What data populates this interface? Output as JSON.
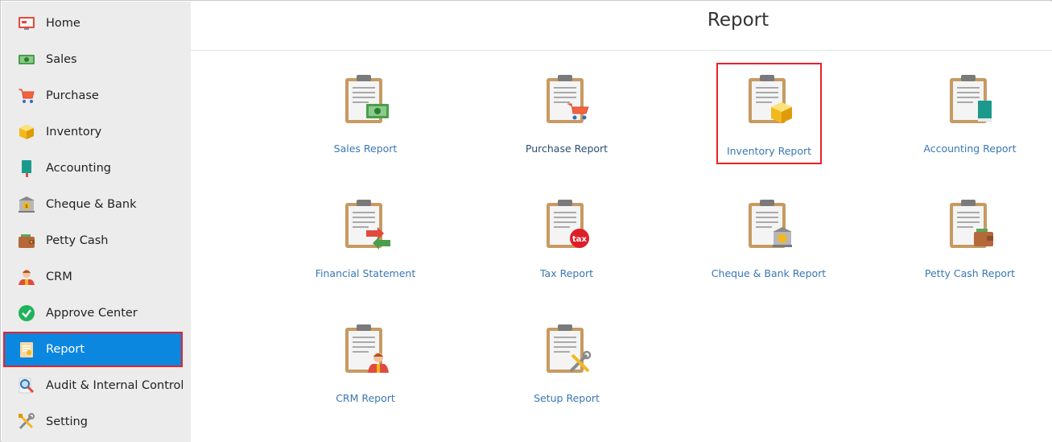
{
  "page": {
    "title": "Report"
  },
  "sidebar": {
    "items": [
      {
        "label": "Home",
        "icon": "home-monitor-icon"
      },
      {
        "label": "Sales",
        "icon": "cash-icon"
      },
      {
        "label": "Purchase",
        "icon": "cart-icon"
      },
      {
        "label": "Inventory",
        "icon": "box-icon"
      },
      {
        "label": "Accounting",
        "icon": "book-icon"
      },
      {
        "label": "Cheque & Bank",
        "icon": "bank-icon"
      },
      {
        "label": "Petty Cash",
        "icon": "wallet-icon"
      },
      {
        "label": "CRM",
        "icon": "people-icon"
      },
      {
        "label": "Approve Center",
        "icon": "check-circle-icon"
      },
      {
        "label": "Report",
        "icon": "report-icon",
        "active": true
      },
      {
        "label": "Audit & Internal Control",
        "icon": "magnifier-icon"
      },
      {
        "label": "Setting",
        "icon": "tools-icon"
      }
    ]
  },
  "reports": [
    {
      "label": "Sales Report",
      "badge": "cash"
    },
    {
      "label": "Purchase Report",
      "badge": "cart"
    },
    {
      "label": "Inventory Report",
      "badge": "box",
      "selected": true
    },
    {
      "label": "Accounting Report",
      "badge": "book"
    },
    {
      "label": "Financial Statement",
      "badge": "exchange"
    },
    {
      "label": "Tax Report",
      "badge": "tax",
      "badge_text": "tax"
    },
    {
      "label": "Cheque & Bank Report",
      "badge": "bank"
    },
    {
      "label": "Petty Cash Report",
      "badge": "wallet"
    },
    {
      "label": "CRM Report",
      "badge": "people"
    },
    {
      "label": "Setup Report",
      "badge": "tools"
    }
  ],
  "colors": {
    "accent": "#0b87e0",
    "highlight": "#e8202a",
    "link": "#3a77b5"
  }
}
